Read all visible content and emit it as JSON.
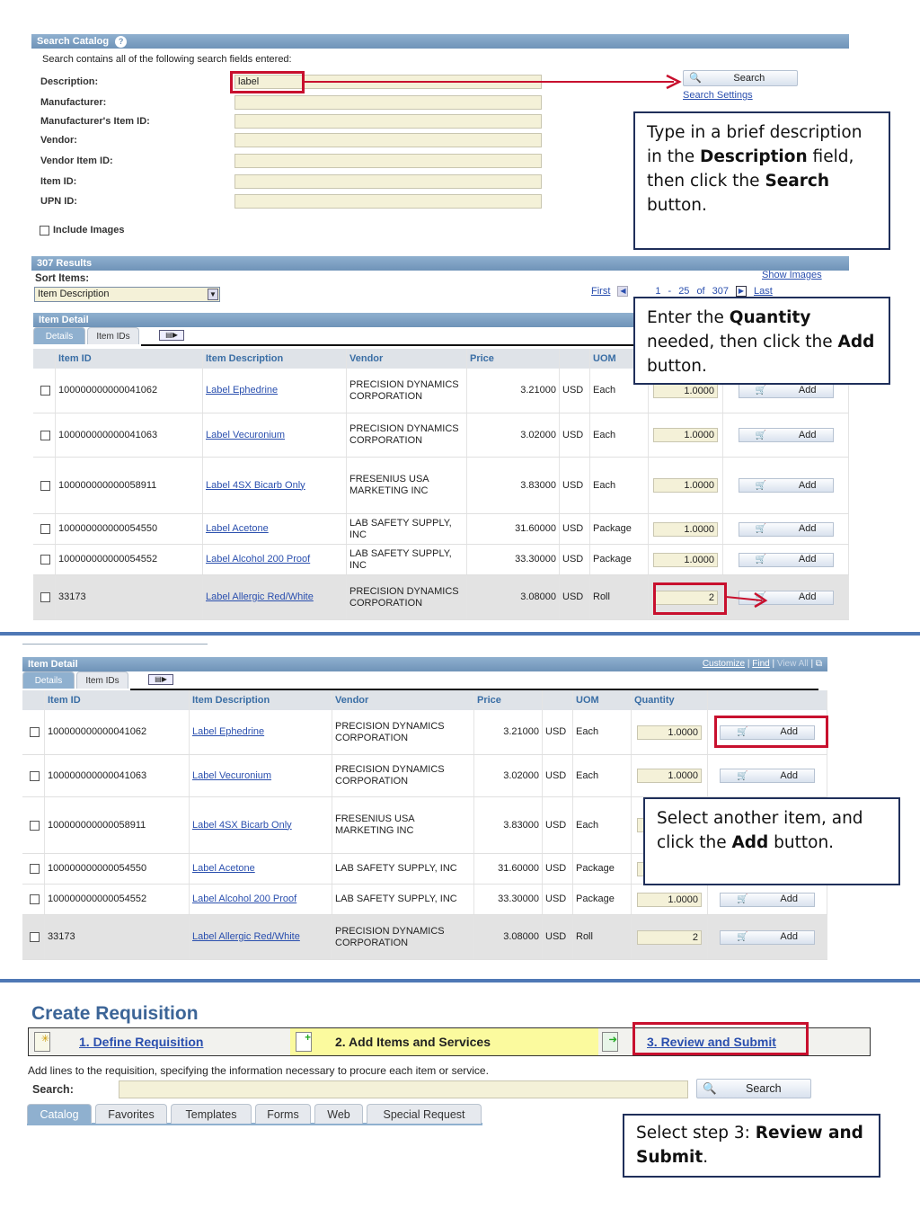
{
  "search": {
    "title": "Search Catalog",
    "help": "?",
    "intro": "Search contains all of the following search fields entered:",
    "fields": [
      {
        "label": "Description:",
        "value": "label"
      },
      {
        "label": "Manufacturer:",
        "value": ""
      },
      {
        "label": "Manufacturer's Item ID:",
        "value": ""
      },
      {
        "label": "Vendor:",
        "value": ""
      },
      {
        "label": "Vendor Item ID:",
        "value": ""
      },
      {
        "label": "Item ID:",
        "value": ""
      },
      {
        "label": "UPN ID:",
        "value": ""
      }
    ],
    "include_images": "Include Images",
    "search_button": "Search",
    "settings_link": "Search Settings"
  },
  "callouts": {
    "c1": [
      "Type in a brief description in the ",
      "Description",
      " field, then click the ",
      "Search",
      " button."
    ],
    "c2": [
      "Enter the ",
      "Quantity",
      " needed, then click the ",
      "Add",
      " button."
    ],
    "c3": [
      "Select another item, and click the ",
      "Add",
      " button."
    ],
    "c4": [
      "Select step 3: ",
      "Review and Submit",
      "."
    ]
  },
  "results": {
    "title": "307 Results",
    "sort_label": "Sort Items:",
    "sort_value": "Item Description",
    "show_images": "Show Images",
    "first": "First",
    "range_start": "1",
    "dash": "-",
    "range_end": "25",
    "of": "of",
    "total": "307",
    "last": "Last"
  },
  "item_detail": {
    "title": "Item Detail",
    "tabs": [
      "Details",
      "Item IDs"
    ],
    "customize": "Customize",
    "find": "Find",
    "view_all": "View All",
    "columns": [
      "Item ID",
      "Item Description",
      "Vendor",
      "Price",
      "UOM",
      "Quantity"
    ],
    "add_label": "Add",
    "rows": [
      {
        "id": "100000000000041062",
        "desc": "Label Ephedrine",
        "vendor": "PRECISION DYNAMICS CORPORATION",
        "price": "3.21000",
        "cur": "USD",
        "uom": "Each",
        "qty": "1.0000"
      },
      {
        "id": "100000000000041063",
        "desc": "Label Vecuronium",
        "vendor": "PRECISION DYNAMICS CORPORATION",
        "price": "3.02000",
        "cur": "USD",
        "uom": "Each",
        "qty": "1.0000"
      },
      {
        "id": "100000000000058911",
        "desc": "Label 4SX Bicarb Only",
        "vendor": "FRESENIUS USA MARKETING INC",
        "price": "3.83000",
        "cur": "USD",
        "uom": "Each",
        "qty": "1.0000"
      },
      {
        "id": "100000000000054550",
        "desc": "Label Acetone",
        "vendor": "LAB SAFETY SUPPLY, INC",
        "price": "31.60000",
        "cur": "USD",
        "uom": "Package",
        "qty": "1.0000"
      },
      {
        "id": "100000000000054552",
        "desc": "Label Alcohol 200 Proof",
        "vendor": "LAB SAFETY SUPPLY, INC",
        "price": "33.30000",
        "cur": "USD",
        "uom": "Package",
        "qty": "1.0000"
      },
      {
        "id": "33173",
        "desc": "Label Allergic Red/White",
        "vendor": "PRECISION DYNAMICS CORPORATION",
        "price": "3.08000",
        "cur": "USD",
        "uom": "Roll",
        "qty": "2"
      }
    ]
  },
  "requisition": {
    "title": "Create Requisition",
    "steps": [
      "1. Define Requisition",
      "2. Add Items and Services",
      "3. Review and Submit"
    ],
    "instruction": "Add lines to the requisition, specifying the information necessary to procure each item or service.",
    "search_label": "Search:",
    "search_value": "",
    "search_button": "Search",
    "tabs": [
      "Catalog",
      "Favorites",
      "Templates",
      "Forms",
      "Web",
      "Special Request"
    ]
  },
  "colors": {
    "header_bar": "#7ea2c6",
    "highlight": "#c8102e",
    "step_active": "#fbfa9e",
    "link": "#2a4fae"
  }
}
